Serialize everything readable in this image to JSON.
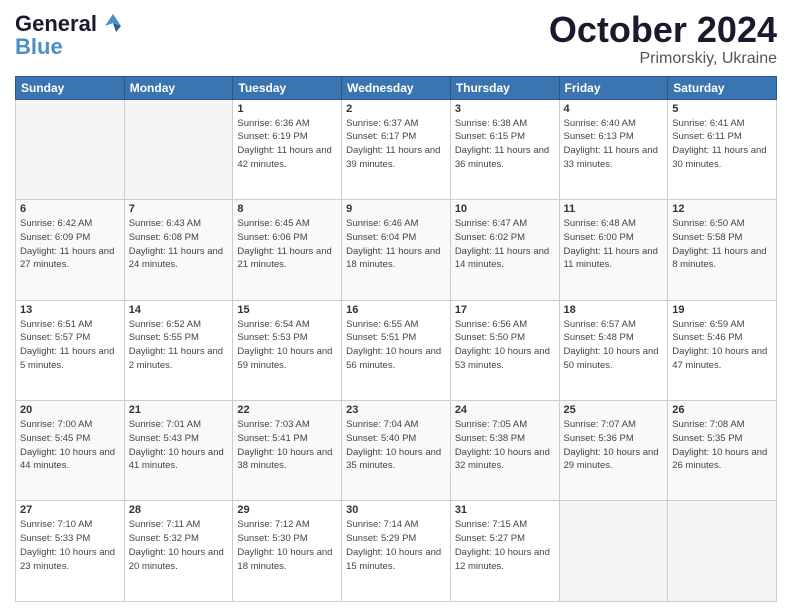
{
  "header": {
    "logo_line1": "General",
    "logo_line2": "Blue",
    "month": "October 2024",
    "location": "Primorskiy, Ukraine"
  },
  "weekdays": [
    "Sunday",
    "Monday",
    "Tuesday",
    "Wednesday",
    "Thursday",
    "Friday",
    "Saturday"
  ],
  "rows": [
    [
      {
        "day": "",
        "info": ""
      },
      {
        "day": "",
        "info": ""
      },
      {
        "day": "1",
        "info": "Sunrise: 6:36 AM\nSunset: 6:19 PM\nDaylight: 11 hours and 42 minutes."
      },
      {
        "day": "2",
        "info": "Sunrise: 6:37 AM\nSunset: 6:17 PM\nDaylight: 11 hours and 39 minutes."
      },
      {
        "day": "3",
        "info": "Sunrise: 6:38 AM\nSunset: 6:15 PM\nDaylight: 11 hours and 36 minutes."
      },
      {
        "day": "4",
        "info": "Sunrise: 6:40 AM\nSunset: 6:13 PM\nDaylight: 11 hours and 33 minutes."
      },
      {
        "day": "5",
        "info": "Sunrise: 6:41 AM\nSunset: 6:11 PM\nDaylight: 11 hours and 30 minutes."
      }
    ],
    [
      {
        "day": "6",
        "info": "Sunrise: 6:42 AM\nSunset: 6:09 PM\nDaylight: 11 hours and 27 minutes."
      },
      {
        "day": "7",
        "info": "Sunrise: 6:43 AM\nSunset: 6:08 PM\nDaylight: 11 hours and 24 minutes."
      },
      {
        "day": "8",
        "info": "Sunrise: 6:45 AM\nSunset: 6:06 PM\nDaylight: 11 hours and 21 minutes."
      },
      {
        "day": "9",
        "info": "Sunrise: 6:46 AM\nSunset: 6:04 PM\nDaylight: 11 hours and 18 minutes."
      },
      {
        "day": "10",
        "info": "Sunrise: 6:47 AM\nSunset: 6:02 PM\nDaylight: 11 hours and 14 minutes."
      },
      {
        "day": "11",
        "info": "Sunrise: 6:48 AM\nSunset: 6:00 PM\nDaylight: 11 hours and 11 minutes."
      },
      {
        "day": "12",
        "info": "Sunrise: 6:50 AM\nSunset: 5:58 PM\nDaylight: 11 hours and 8 minutes."
      }
    ],
    [
      {
        "day": "13",
        "info": "Sunrise: 6:51 AM\nSunset: 5:57 PM\nDaylight: 11 hours and 5 minutes."
      },
      {
        "day": "14",
        "info": "Sunrise: 6:52 AM\nSunset: 5:55 PM\nDaylight: 11 hours and 2 minutes."
      },
      {
        "day": "15",
        "info": "Sunrise: 6:54 AM\nSunset: 5:53 PM\nDaylight: 10 hours and 59 minutes."
      },
      {
        "day": "16",
        "info": "Sunrise: 6:55 AM\nSunset: 5:51 PM\nDaylight: 10 hours and 56 minutes."
      },
      {
        "day": "17",
        "info": "Sunrise: 6:56 AM\nSunset: 5:50 PM\nDaylight: 10 hours and 53 minutes."
      },
      {
        "day": "18",
        "info": "Sunrise: 6:57 AM\nSunset: 5:48 PM\nDaylight: 10 hours and 50 minutes."
      },
      {
        "day": "19",
        "info": "Sunrise: 6:59 AM\nSunset: 5:46 PM\nDaylight: 10 hours and 47 minutes."
      }
    ],
    [
      {
        "day": "20",
        "info": "Sunrise: 7:00 AM\nSunset: 5:45 PM\nDaylight: 10 hours and 44 minutes."
      },
      {
        "day": "21",
        "info": "Sunrise: 7:01 AM\nSunset: 5:43 PM\nDaylight: 10 hours and 41 minutes."
      },
      {
        "day": "22",
        "info": "Sunrise: 7:03 AM\nSunset: 5:41 PM\nDaylight: 10 hours and 38 minutes."
      },
      {
        "day": "23",
        "info": "Sunrise: 7:04 AM\nSunset: 5:40 PM\nDaylight: 10 hours and 35 minutes."
      },
      {
        "day": "24",
        "info": "Sunrise: 7:05 AM\nSunset: 5:38 PM\nDaylight: 10 hours and 32 minutes."
      },
      {
        "day": "25",
        "info": "Sunrise: 7:07 AM\nSunset: 5:36 PM\nDaylight: 10 hours and 29 minutes."
      },
      {
        "day": "26",
        "info": "Sunrise: 7:08 AM\nSunset: 5:35 PM\nDaylight: 10 hours and 26 minutes."
      }
    ],
    [
      {
        "day": "27",
        "info": "Sunrise: 7:10 AM\nSunset: 5:33 PM\nDaylight: 10 hours and 23 minutes."
      },
      {
        "day": "28",
        "info": "Sunrise: 7:11 AM\nSunset: 5:32 PM\nDaylight: 10 hours and 20 minutes."
      },
      {
        "day": "29",
        "info": "Sunrise: 7:12 AM\nSunset: 5:30 PM\nDaylight: 10 hours and 18 minutes."
      },
      {
        "day": "30",
        "info": "Sunrise: 7:14 AM\nSunset: 5:29 PM\nDaylight: 10 hours and 15 minutes."
      },
      {
        "day": "31",
        "info": "Sunrise: 7:15 AM\nSunset: 5:27 PM\nDaylight: 10 hours and 12 minutes."
      },
      {
        "day": "",
        "info": ""
      },
      {
        "day": "",
        "info": ""
      }
    ]
  ]
}
